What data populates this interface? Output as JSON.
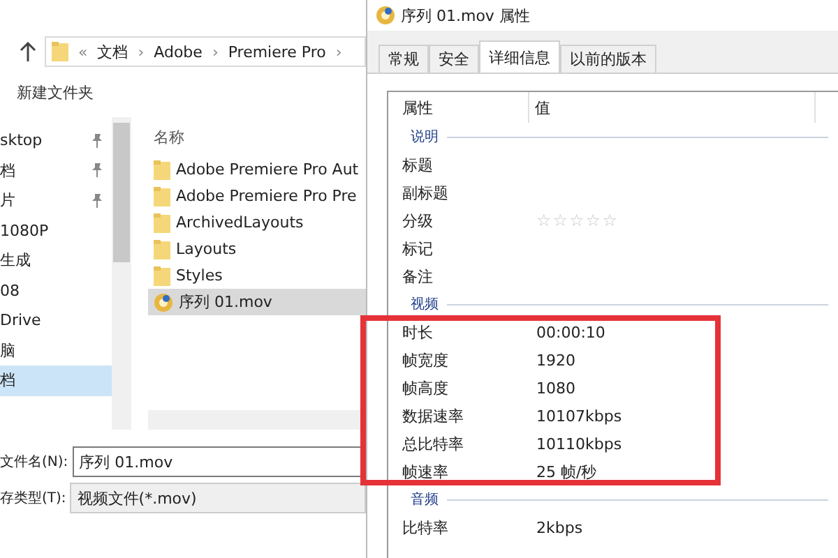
{
  "explorer": {
    "breadcrumb": [
      "«",
      "文档",
      "›",
      "Adobe",
      "›",
      "Premiere Pro",
      "›"
    ],
    "toolbar": [
      "新建文件夹"
    ],
    "sidebar": [
      {
        "label": "sktop",
        "pinned": true,
        "selected": false
      },
      {
        "label": "档",
        "pinned": true,
        "selected": false
      },
      {
        "label": "片",
        "pinned": true,
        "selected": false
      },
      {
        "label": "1080P",
        "pinned": false,
        "selected": false
      },
      {
        "label": "生成",
        "pinned": false,
        "selected": false
      },
      {
        "label": "08",
        "pinned": false,
        "selected": false
      },
      {
        "label": "Drive",
        "pinned": false,
        "selected": false
      },
      {
        "label": "脑",
        "pinned": false,
        "selected": false
      },
      {
        "label": "档",
        "pinned": false,
        "selected": true
      }
    ],
    "column": "名称",
    "files": [
      {
        "name": "Adobe Premiere Pro Aut",
        "kind": "folder",
        "selected": false
      },
      {
        "name": "Adobe Premiere Pro Pre",
        "kind": "folder",
        "selected": false
      },
      {
        "name": "ArchivedLayouts",
        "kind": "folder",
        "selected": false
      },
      {
        "name": "Layouts",
        "kind": "folder",
        "selected": false
      },
      {
        "name": "Styles",
        "kind": "folder",
        "selected": false
      },
      {
        "name": "序列 01.mov",
        "kind": "video",
        "selected": true
      }
    ],
    "fields": [
      {
        "label": "文件名(N):",
        "value": "序列 01.mov",
        "editable": true
      },
      {
        "label": "存类型(T):",
        "value": "视频文件(*.mov)",
        "editable": false
      }
    ]
  },
  "dialog": {
    "title": "序列 01.mov 属性",
    "tabs": [
      {
        "label": "常规",
        "selected": false
      },
      {
        "label": "安全",
        "selected": false
      },
      {
        "label": "详细信息",
        "selected": true
      },
      {
        "label": "以前的版本",
        "selected": false
      }
    ],
    "columns": [
      "属性",
      "值"
    ],
    "sections": [
      {
        "title": "说明",
        "rows": [
          {
            "kind": "text",
            "name": "标题"
          },
          {
            "kind": "text",
            "name": "副标题"
          },
          {
            "kind": "rating",
            "name": "分级",
            "stars": 0
          },
          {
            "kind": "text",
            "name": "标记"
          },
          {
            "kind": "text",
            "name": "备注"
          }
        ]
      },
      {
        "title": "视频",
        "rows": [
          {
            "kind": "text",
            "name": "时长",
            "value": "00:00:10"
          },
          {
            "kind": "text",
            "name": "帧宽度",
            "value": "1920"
          },
          {
            "kind": "text",
            "name": "帧高度",
            "value": "1080"
          },
          {
            "kind": "text",
            "name": "数据速率",
            "value": "10107kbps"
          },
          {
            "kind": "text",
            "name": "总比特率",
            "value": "10110kbps"
          },
          {
            "kind": "text",
            "name": "帧速率",
            "value": "25 帧/秒"
          }
        ]
      },
      {
        "title": "音频",
        "rows": [
          {
            "kind": "text",
            "name": "比特率",
            "value": "2kbps"
          }
        ]
      }
    ]
  },
  "annotations": [
    {
      "kind": "frame"
    }
  ]
}
